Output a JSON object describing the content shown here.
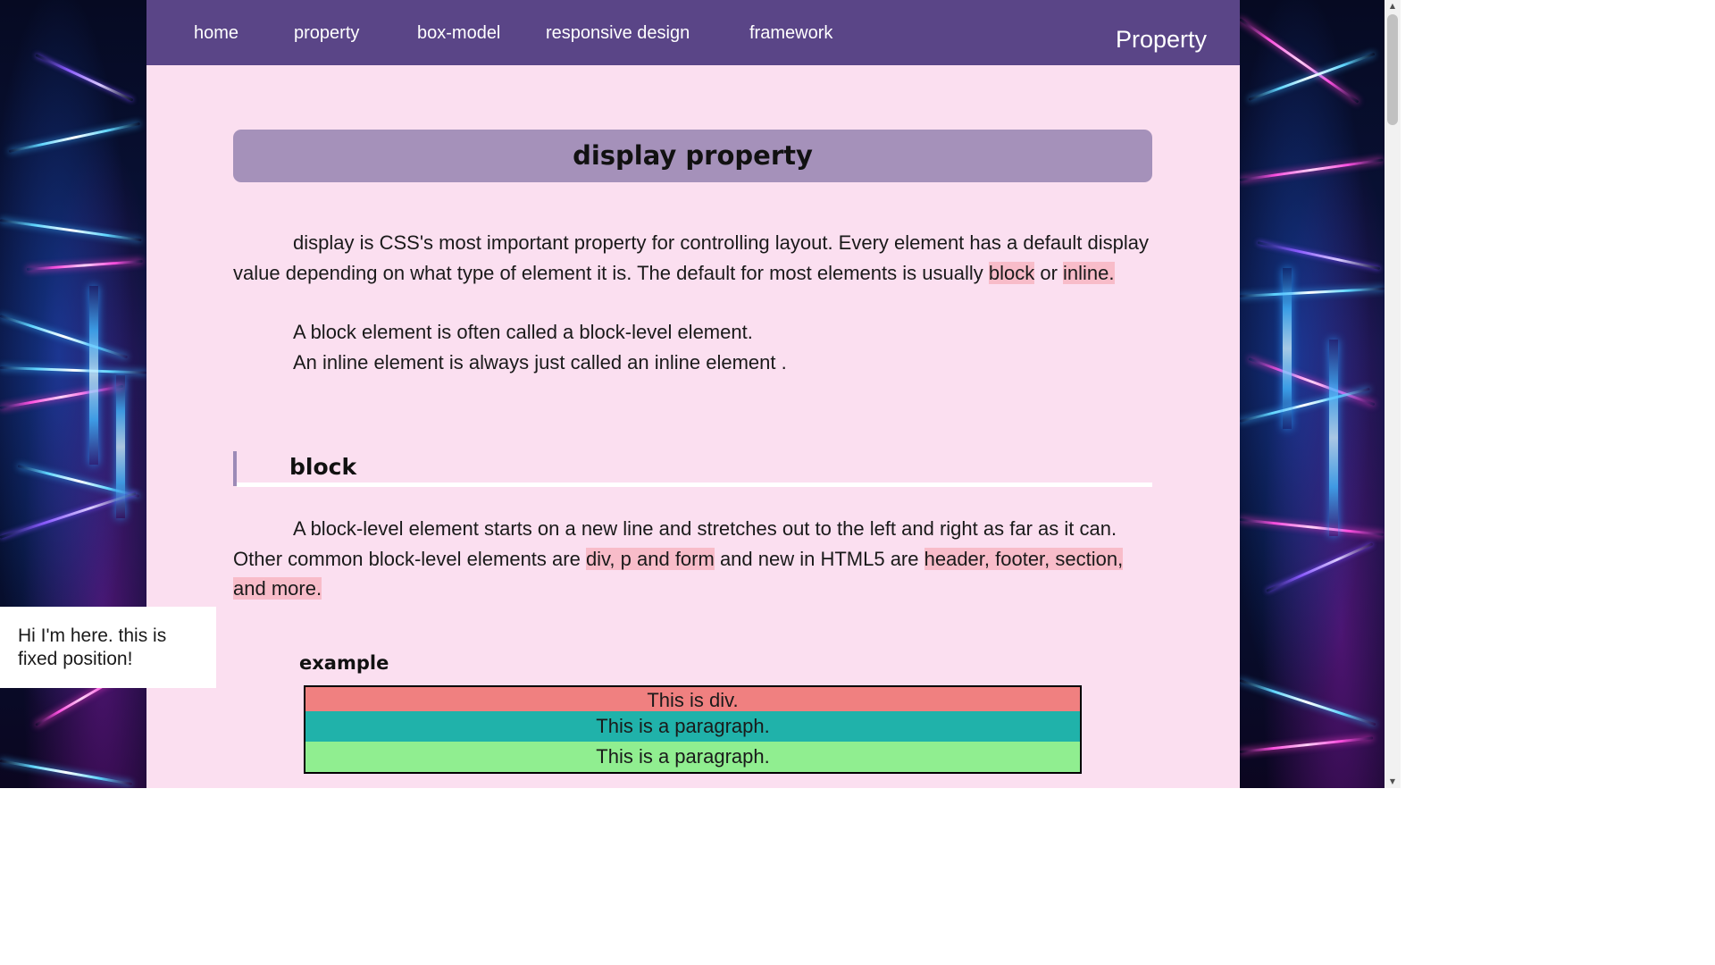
{
  "nav": {
    "links": [
      "home",
      "property",
      "box-model",
      "responsive design",
      "framework"
    ],
    "brand": "Property"
  },
  "main": {
    "title": "display property",
    "intro": {
      "text1": "display is CSS's most important property for controlling layout. Every element has a default display value depending on what type of element it is. The default for most elements is usually ",
      "hl1": "block",
      "text2": " or ",
      "hl2": "inline."
    },
    "line_block": "A block element is often called a block-level element.",
    "line_inline": "An inline element is always just called an inline element .",
    "section": {
      "heading": "block",
      "para": {
        "text1": "A block-level element starts on a new line and stretches out to the left and right as far as it can. Other common block-level elements are ",
        "hl1": "div, p and form",
        "text2": " and new in HTML5 are ",
        "hl2": "header, footer, section, and more."
      }
    },
    "example": {
      "label": "example",
      "div_text": "This is div.",
      "p1_text": "This is a paragraph.",
      "p2_text": "This is a paragraph."
    }
  },
  "fixed_note": "Hi I'm here. this is fixed position!",
  "colors": {
    "navbar": "#5a4587",
    "page_bg": "#fbdff0",
    "title_banner": "#a591ba",
    "highlight": "#f8bcc9",
    "example_div": "#f08080",
    "example_p1": "#20b2aa",
    "example_p2": "#90ee90"
  },
  "icons": {
    "scroll_up": "scroll-up-arrow-icon",
    "scroll_down": "scroll-down-arrow-icon"
  }
}
